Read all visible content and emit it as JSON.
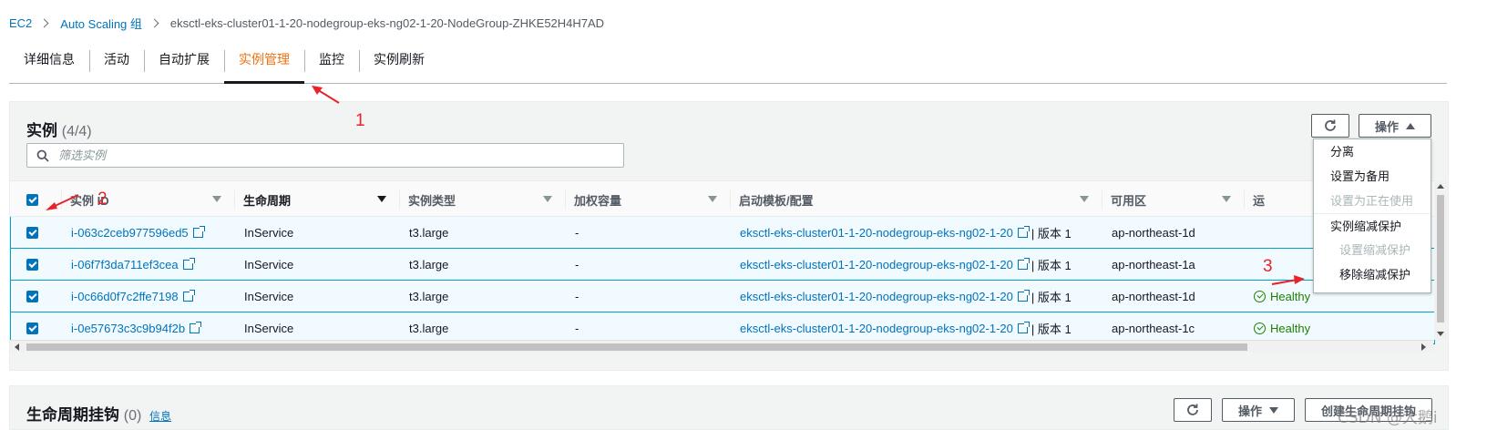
{
  "breadcrumb": {
    "items": [
      "EC2",
      "Auto Scaling 组"
    ],
    "current": "eksctl-eks-cluster01-1-20-nodegroup-eks-ng02-1-20-NodeGroup-ZHKE52H4H7AD"
  },
  "tabs": [
    {
      "label": "详细信息"
    },
    {
      "label": "活动"
    },
    {
      "label": "自动扩展"
    },
    {
      "label": "实例管理",
      "active": true
    },
    {
      "label": "监控"
    },
    {
      "label": "实例刷新"
    }
  ],
  "instances": {
    "title": "实例",
    "count": "(4/4)",
    "actions_label": "操作",
    "search_placeholder": "筛选实例",
    "columns": [
      "实例 ID",
      "生命周期",
      "实例类型",
      "加权容量",
      "启动模板/配置",
      "可用区",
      "运"
    ],
    "rows": [
      {
        "id": "i-063c2ceb977596ed5",
        "lifecycle": "InService",
        "type": "t3.large",
        "weight": "-",
        "template": "eksctl-eks-cluster01-1-20-nodegroup-eks-ng02-1-20",
        "version": "| 版本 1",
        "az": "ap-northeast-1d",
        "health": ""
      },
      {
        "id": "i-06f7f3da711ef3cea",
        "lifecycle": "InService",
        "type": "t3.large",
        "weight": "-",
        "template": "eksctl-eks-cluster01-1-20-nodegroup-eks-ng02-1-20",
        "version": "| 版本 1",
        "az": "ap-northeast-1a",
        "health": ""
      },
      {
        "id": "i-0c66d0f7c2ffe7198",
        "lifecycle": "InService",
        "type": "t3.large",
        "weight": "-",
        "template": "eksctl-eks-cluster01-1-20-nodegroup-eks-ng02-1-20",
        "version": "| 版本 1",
        "az": "ap-northeast-1d",
        "health": "Healthy"
      },
      {
        "id": "i-0e57673c3c9b94f2b",
        "lifecycle": "InService",
        "type": "t3.large",
        "weight": "-",
        "template": "eksctl-eks-cluster01-1-20-nodegroup-eks-ng02-1-20",
        "version": "| 版本 1",
        "az": "ap-northeast-1c",
        "health": "Healthy"
      }
    ]
  },
  "dropdown": {
    "items": [
      {
        "label": "分离",
        "disabled": false
      },
      {
        "label": "设置为备用",
        "disabled": false
      },
      {
        "label": "设置为正在使用",
        "disabled": true
      },
      {
        "label": "实例缩减保护",
        "disabled": false
      },
      {
        "label": "设置缩减保护",
        "disabled": true
      },
      {
        "label": "移除缩减保护",
        "disabled": false
      }
    ]
  },
  "annotations": [
    "1",
    "2",
    "3"
  ],
  "lifecycle_hooks": {
    "title": "生命周期挂钩",
    "count": "(0)",
    "info": "信息",
    "actions_label": "操作",
    "create_label": "创建生命周期挂钩"
  },
  "watermark": "CSDN @大鹅i",
  "colors": {
    "accent": "#ec7211",
    "link": "#0073bb",
    "healthy": "#1d8102",
    "annotation": "#e8232a"
  }
}
